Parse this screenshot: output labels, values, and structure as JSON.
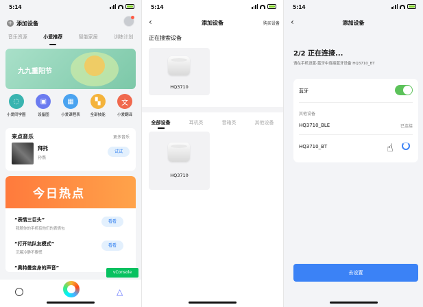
{
  "status": {
    "time": "5:14"
  },
  "screen1": {
    "header_title": "添加设备",
    "tabs": [
      "音乐资源",
      "小爱推荐",
      "智能家居",
      "训练计划"
    ],
    "banner_text": "九九重阳节",
    "quick": [
      {
        "label": "小爱同学圈",
        "color": "#3ab4b0"
      },
      {
        "label": "设备图",
        "color": "#6b7bf0"
      },
      {
        "label": "小爱课程表",
        "color": "#4aa3f0"
      },
      {
        "label": "全部技能",
        "color": "#f4b33b"
      },
      {
        "label": "小爱翻译",
        "color": "#f0694e"
      }
    ],
    "music": {
      "title": "来点音乐",
      "more": "更多音乐",
      "song": "拜托",
      "artist": "孙燕",
      "try": "试试"
    },
    "hot": {
      "banner": "今日热点",
      "items": [
        {
          "q": "“表情三巨头”",
          "s": "我随你的手机有他们的表情包",
          "btn": "看看"
        },
        {
          "q": "“打开坑队友模式”",
          "s": "沉着冷静不要慌",
          "btn": "看看"
        },
        {
          "q": "“奥特曼变身的声音”",
          "s": "",
          "btn": ""
        }
      ]
    },
    "vconsole": "vConsole"
  },
  "screen2": {
    "title": "添加设备",
    "right": "购买设备",
    "searching": "正在搜索设备",
    "found_device": "HQ3710",
    "tabs": [
      "全部设备",
      "耳机类",
      "音箱类",
      "其他设备"
    ],
    "list_device": "HQ3710"
  },
  "screen3": {
    "title": "添加设备",
    "step": "2/2  正在连接...",
    "hint": "请在手机设置-蓝牙中连接蓝牙设备 HQ3710_BT",
    "bluetooth": "蓝牙",
    "other": "其他设备",
    "dev1": "HQ3710_BLE",
    "dev1_status": "已连接",
    "dev2": "HQ3710_BT",
    "go": "去设置"
  }
}
